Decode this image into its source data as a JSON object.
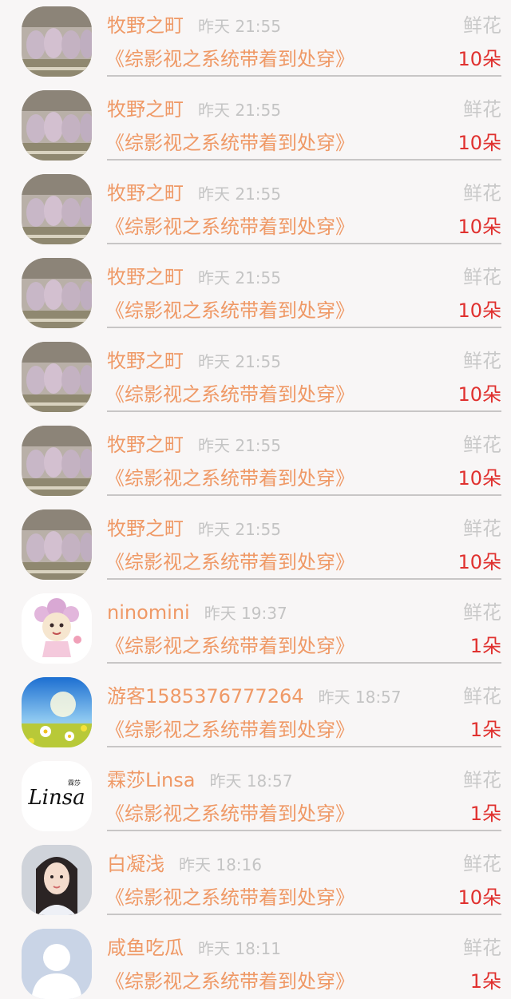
{
  "rows": [
    {
      "name": "牧野之町",
      "time": "昨天 21:55",
      "gift": "鲜花",
      "book": "《综影视之系统带着到处穿》",
      "count": "10朵",
      "avatar": "cat-photo-icon"
    },
    {
      "name": "牧野之町",
      "time": "昨天 21:55",
      "gift": "鲜花",
      "book": "《综影视之系统带着到处穿》",
      "count": "10朵",
      "avatar": "cat-photo-icon"
    },
    {
      "name": "牧野之町",
      "time": "昨天 21:55",
      "gift": "鲜花",
      "book": "《综影视之系统带着到处穿》",
      "count": "10朵",
      "avatar": "cat-photo-icon"
    },
    {
      "name": "牧野之町",
      "time": "昨天 21:55",
      "gift": "鲜花",
      "book": "《综影视之系统带着到处穿》",
      "count": "10朵",
      "avatar": "cat-photo-icon"
    },
    {
      "name": "牧野之町",
      "time": "昨天 21:55",
      "gift": "鲜花",
      "book": "《综影视之系统带着到处穿》",
      "count": "10朵",
      "avatar": "cat-photo-icon"
    },
    {
      "name": "牧野之町",
      "time": "昨天 21:55",
      "gift": "鲜花",
      "book": "《综影视之系统带着到处穿》",
      "count": "10朵",
      "avatar": "cat-photo-icon"
    },
    {
      "name": "牧野之町",
      "time": "昨天 21:55",
      "gift": "鲜花",
      "book": "《综影视之系统带着到处穿》",
      "count": "10朵",
      "avatar": "cat-photo-icon"
    },
    {
      "name": "ninomini",
      "time": "昨天 19:37",
      "gift": "鲜花",
      "book": "《综影视之系统带着到处穿》",
      "count": "1朵",
      "avatar": "cartoon-girl-icon"
    },
    {
      "name": "游客1585376777264",
      "time": "昨天 18:57",
      "gift": "鲜花",
      "book": "《综影视之系统带着到处穿》",
      "count": "1朵",
      "avatar": "flower-field-icon"
    },
    {
      "name": "霖莎Linsa",
      "time": "昨天 18:57",
      "gift": "鲜花",
      "book": "《综影视之系统带着到处穿》",
      "count": "1朵",
      "avatar": "linsa-logo-icon",
      "logo_text": "Linsa",
      "logo_small": "霖莎"
    },
    {
      "name": "白凝浅",
      "time": "昨天 18:16",
      "gift": "鲜花",
      "book": "《综影视之系统带着到处穿》",
      "count": "10朵",
      "avatar": "woman-portrait-icon"
    },
    {
      "name": "咸鱼吃瓜",
      "time": "昨天 18:11",
      "gift": "鲜花",
      "book": "《综影视之系统带着到处穿》",
      "count": "1朵",
      "avatar": "default-user-icon"
    }
  ]
}
